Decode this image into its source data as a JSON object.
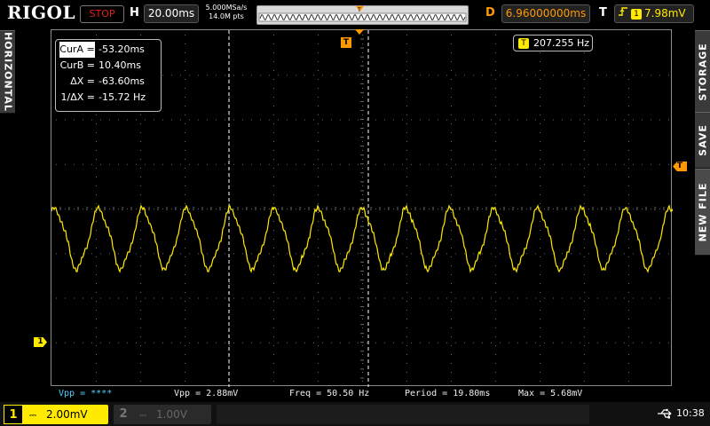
{
  "brand": "RIGOL",
  "status": "STOP",
  "horizontal": {
    "letter": "H",
    "scale": "20.00ms",
    "sample_rate": "5.000MSa/s",
    "mem_depth": "14.0M pts"
  },
  "delay": {
    "letter": "D",
    "value": "6.96000000ms"
  },
  "trigger": {
    "letter": "T",
    "source": "1",
    "slope_icon": "rising-edge-icon",
    "level": "7.98mV"
  },
  "left_tab": "HORIZONTAL",
  "right_tabs": [
    "STORAGE",
    "SAVE",
    "NEW FILE"
  ],
  "cursor_readout": {
    "cur_a_label": "CurA =",
    "cur_a_value": "-53.20ms",
    "cur_b_label": "CurB =",
    "cur_b_value": "10.40ms",
    "dx_label": "ΔX =",
    "dx_value": "-63.60ms",
    "inv_dx_label": "1/ΔX =",
    "inv_dx_value": "-15.72 Hz"
  },
  "freq_counter": {
    "icon": "T",
    "value": "207.255 Hz"
  },
  "markers": {
    "trigger_position": "T",
    "channel1": "1",
    "trigger_level": "T"
  },
  "measurements": [
    {
      "label": "Vpp =",
      "value": "****",
      "color": "#4fd2ff"
    },
    {
      "label": "Vpp =",
      "value": "2.88mV",
      "color": "#eeeeee"
    },
    {
      "label": "Freq =",
      "value": "50.50 Hz",
      "color": "#eeeeee"
    },
    {
      "label": "Period =",
      "value": "19.80ms",
      "color": "#eeeeee"
    },
    {
      "label": "Max =",
      "value": "5.68mV",
      "color": "#eeeeee"
    }
  ],
  "channels": [
    {
      "number": "1",
      "coupling_icon": "dc-coupling-icon",
      "coupling": "⎓",
      "scale": "2.00mV",
      "active": true,
      "color": "#ffea00"
    },
    {
      "number": "2",
      "coupling_icon": "dc-coupling-icon",
      "coupling": "⎓",
      "scale": "1.00V",
      "active": false,
      "color": "#666666"
    }
  ],
  "usb_icon": "usb-icon",
  "clock": "10:38",
  "colors": {
    "ch1": "#ffea00",
    "trigger": "#ff9900",
    "measure_cyan": "#4fd2ff",
    "stop": "#e0201a"
  },
  "waveform": {
    "cycles_visible": 14.14,
    "amplitude_mV": 1.44,
    "trace_color": "#ffea00"
  }
}
